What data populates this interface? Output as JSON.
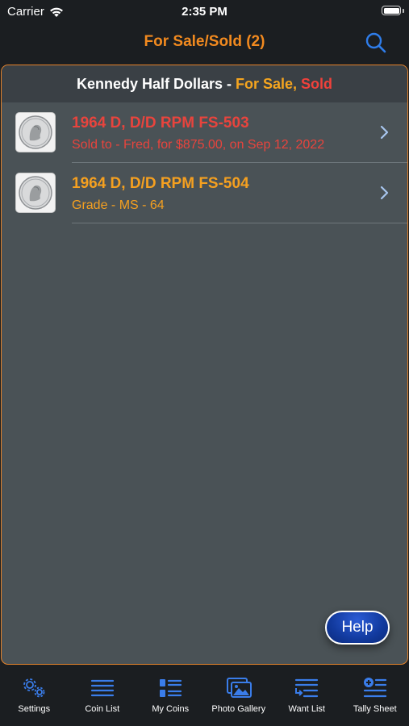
{
  "status_bar": {
    "carrier": "Carrier",
    "time": "2:35 PM",
    "battery_level": 1.0
  },
  "nav": {
    "title": "For Sale/Sold (2)",
    "search_icon": "search-icon"
  },
  "section": {
    "prefix": "Kennedy Half Dollars - ",
    "for_sale": "For Sale",
    "comma": ", ",
    "sold": "Sold"
  },
  "items": [
    {
      "title": "1964 D, D/D RPM FS-503",
      "subtitle": "Sold to - Fred, for $875.00, on Sep 12, 2022",
      "status": "sold",
      "color": "#e8443d"
    },
    {
      "title": "1964 D, D/D RPM FS-504",
      "subtitle": "Grade - MS - 64",
      "status": "for_sale",
      "color": "#f5a020"
    }
  ],
  "help_label": "Help",
  "tabs": [
    {
      "label": "Settings",
      "icon": "gears-icon"
    },
    {
      "label": "Coin List",
      "icon": "list-icon"
    },
    {
      "label": "My Coins",
      "icon": "grid-list-icon"
    },
    {
      "label": "Photo Gallery",
      "icon": "photos-icon"
    },
    {
      "label": "Want List",
      "icon": "want-list-icon"
    },
    {
      "label": "Tally Sheet",
      "icon": "tally-add-icon"
    }
  ],
  "colors": {
    "accent_orange": "#f28a1f",
    "sold_red": "#e8443d",
    "for_sale_orange": "#f5a020",
    "icon_blue": "#3a7dea"
  }
}
